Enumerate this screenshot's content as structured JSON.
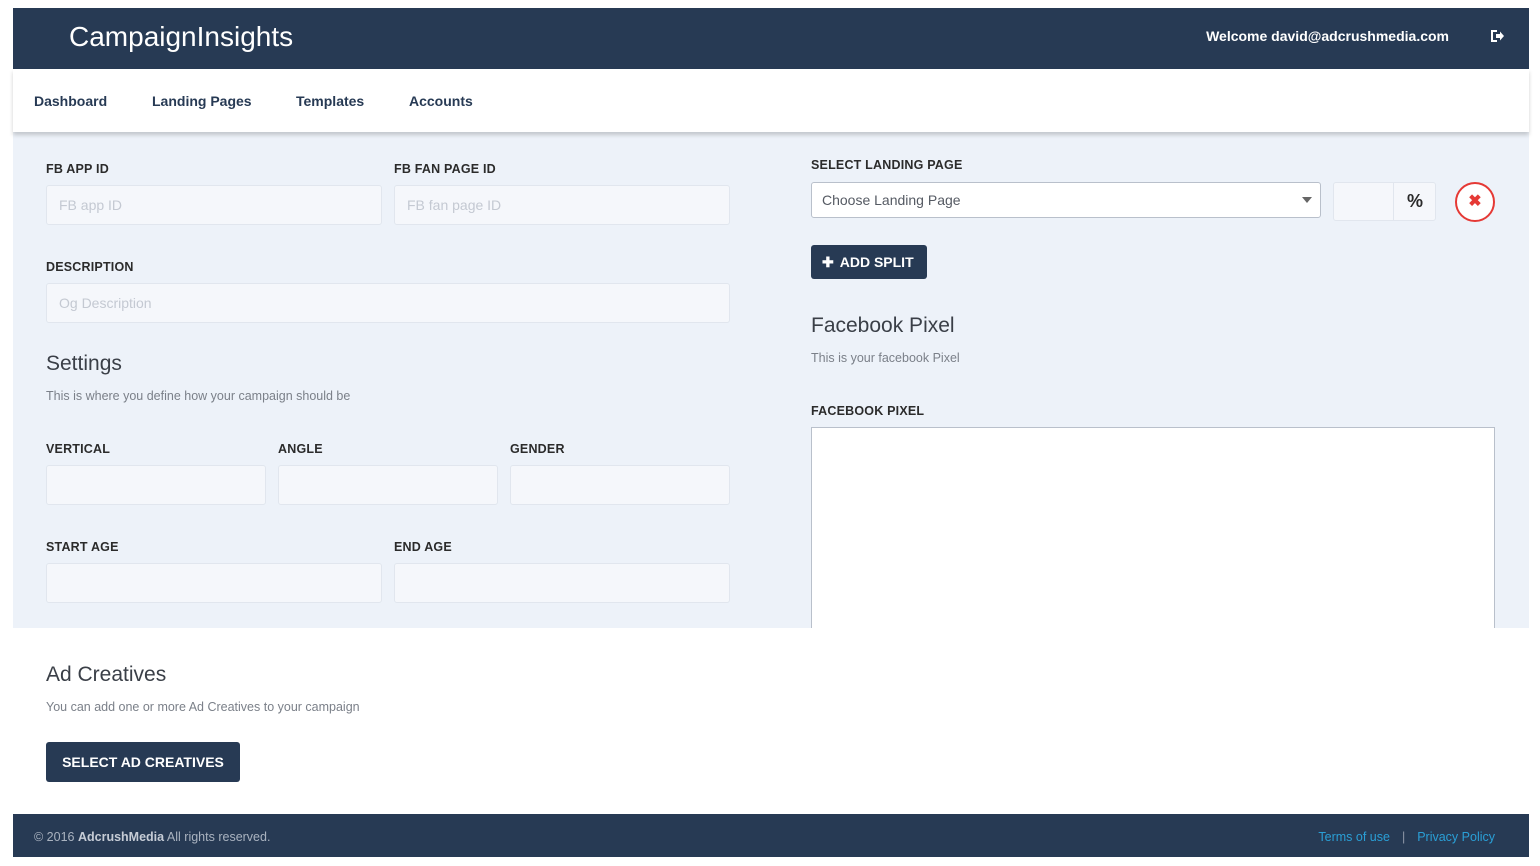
{
  "header": {
    "brand": "CampaignInsights",
    "welcome": "Welcome david@adcrushmedia.com",
    "logout_icon": "sign-out-icon"
  },
  "nav": {
    "items": [
      "Dashboard",
      "Landing Pages",
      "Templates",
      "Accounts"
    ]
  },
  "form": {
    "fb_app_id": {
      "label": "FB APP ID",
      "placeholder": "FB app ID"
    },
    "fb_fan_page_id": {
      "label": "FB FAN PAGE ID",
      "placeholder": "FB fan page ID"
    },
    "description": {
      "label": "DESCRIPTION",
      "placeholder": "Og Description"
    }
  },
  "settings": {
    "title": "Settings",
    "subtitle": "This is where you define how your campaign should be",
    "vertical_label": "VERTICAL",
    "angle_label": "ANGLE",
    "gender_label": "GENDER",
    "start_age_label": "START AGE",
    "end_age_label": "END AGE"
  },
  "landing": {
    "label": "SELECT LANDING PAGE",
    "select_value": "Choose Landing Page",
    "percent_sign": "%",
    "remove_glyph": "✖",
    "add_split": "ADD SPLIT",
    "add_split_glyph": "✚"
  },
  "pixel": {
    "title": "Facebook Pixel",
    "subtitle": "This is your facebook Pixel",
    "label": "FACEBOOK PIXEL"
  },
  "creatives": {
    "title": "Ad Creatives",
    "subtitle": "You can add one or more Ad Creatives to your campaign",
    "button": "SELECT AD CREATIVES"
  },
  "footer": {
    "copyright_prefix": "© 2016",
    "company": "AdcrushMedia",
    "copyright_suffix": "All rights reserved.",
    "terms": "Terms of use",
    "separator": "|",
    "privacy": "Privacy Policy"
  },
  "colors": {
    "navy": "#273a54",
    "panel_bg": "#edf2f9",
    "danger": "#e53935",
    "link": "#2a9fd6"
  }
}
